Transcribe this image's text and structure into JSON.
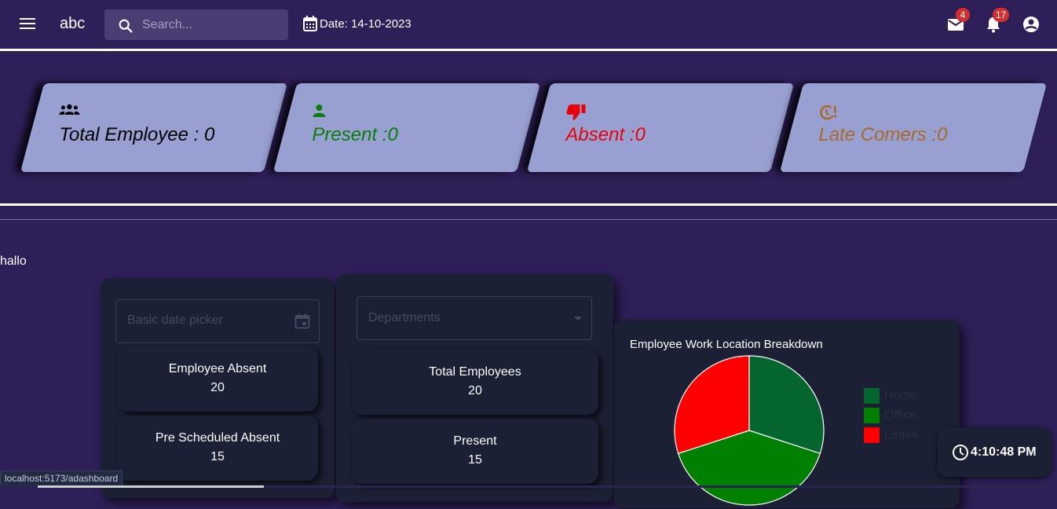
{
  "header": {
    "brand": "abc",
    "search_placeholder": "Search...",
    "date_text": "Date: 14-10-2023",
    "mail_badge": "4",
    "notifications_badge": "17"
  },
  "summary_cards": [
    {
      "label": "Total Employee : 0",
      "color": "#000000",
      "icon": "group-icon"
    },
    {
      "label": "Present :0",
      "color": "#0a7d0a",
      "icon": "person-icon"
    },
    {
      "label": "Absent :0",
      "color": "#e8000b",
      "icon": "thumb-down-icon"
    },
    {
      "label": "Late Comers :0",
      "color": "#a9692a",
      "icon": "late-clock-icon"
    }
  ],
  "greeting": "hallo",
  "left_panel": {
    "date_picker_placeholder": "Basic date picker",
    "stats": [
      {
        "title": "Employee Absent",
        "value": "20"
      },
      {
        "title": "Pre Scheduled Absent",
        "value": "15"
      }
    ]
  },
  "middle_panel": {
    "department_placeholder": "Departments",
    "stats": [
      {
        "title": "Total Employees",
        "value": "20"
      },
      {
        "title": "Present",
        "value": "15"
      }
    ]
  },
  "chart_data": {
    "type": "pie",
    "title": "Employee Work Location Breakdown",
    "categories": [
      "Home",
      "Office",
      "Leave"
    ],
    "values": [
      30,
      40,
      30
    ],
    "colors": [
      "#04652f",
      "#008000",
      "#ff0000"
    ],
    "legend": "right"
  },
  "clock": {
    "time": "4:10:48 PM"
  },
  "status_bar": {
    "url": "localhost:5173/adashboard"
  }
}
